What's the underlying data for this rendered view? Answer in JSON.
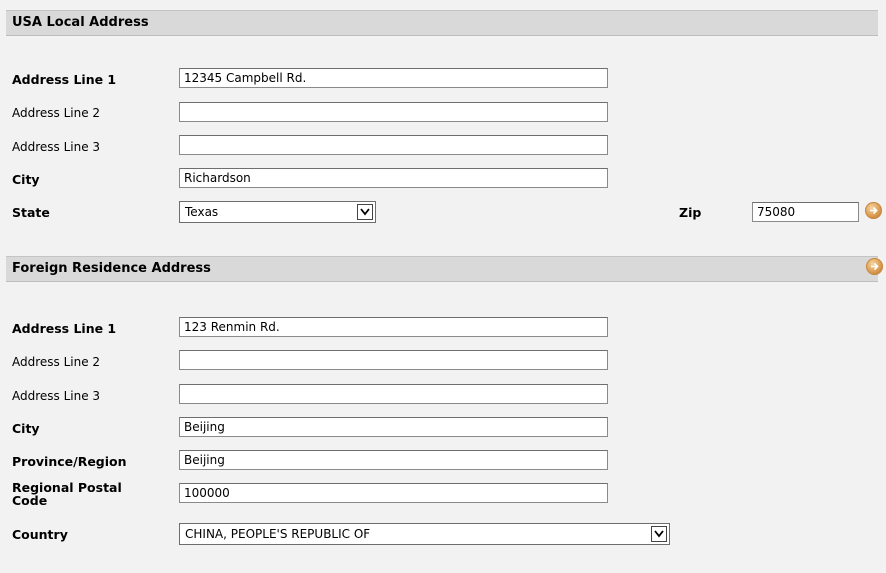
{
  "usa": {
    "header": "USA Local Address",
    "address1_label": "Address Line 1",
    "address1_value": "12345 Campbell Rd.",
    "address2_label": "Address Line 2",
    "address2_value": "",
    "address3_label": "Address Line 3",
    "address3_value": "",
    "city_label": "City",
    "city_value": "Richardson",
    "state_label": "State",
    "state_value": "Texas",
    "zip_label": "Zip",
    "zip_value": "75080"
  },
  "foreign": {
    "header": "Foreign Residence Address",
    "address1_label": "Address Line 1",
    "address1_value": "123 Renmin Rd.",
    "address2_label": "Address Line 2",
    "address2_value": "",
    "address3_label": "Address Line 3",
    "address3_value": "",
    "city_label": "City",
    "city_value": "Beijing",
    "province_label": "Province/Region",
    "province_value": "Beijing",
    "postal_label_line1": "Regional Postal",
    "postal_label_line2": "Code",
    "postal_value": "100000",
    "country_label": "Country",
    "country_value": "CHINA, PEOPLE'S REPUBLIC OF"
  },
  "icons": {
    "help": "help-arrow-icon",
    "dropdown": "chevron-down-icon"
  },
  "colors": {
    "header_bg": "#d9d9d9",
    "page_bg": "#f2f2f2",
    "help_icon": "#d89a4e"
  }
}
